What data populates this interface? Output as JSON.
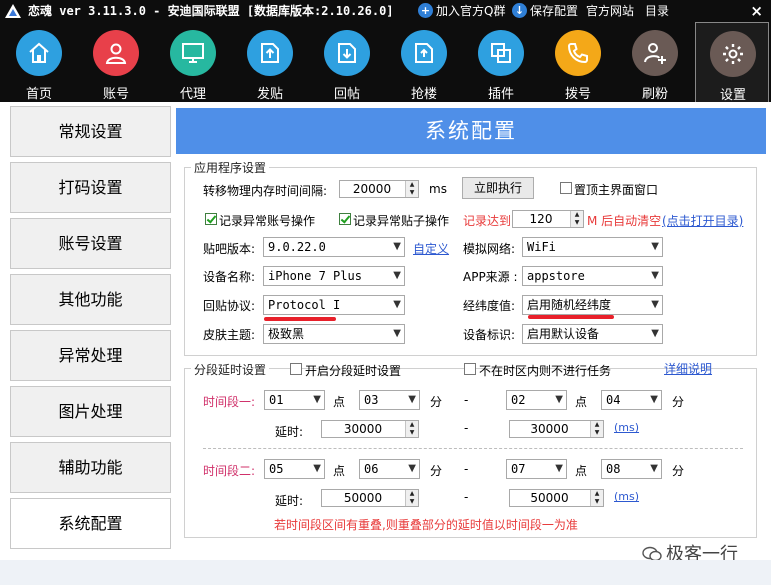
{
  "titlebar": {
    "title": "恋魂 ver 3.11.3.0 - 安迪国际联盟 [数据库版本:2.10.26.0]",
    "join_group": "加入官方Q群",
    "save_config": "保存配置",
    "official_site": "官方网站",
    "directory": "目录",
    "close": "×"
  },
  "toolbar": {
    "items": [
      {
        "label": "首页",
        "icon": "home-icon",
        "color": "#2ea0e0"
      },
      {
        "label": "账号",
        "icon": "user-icon",
        "color": "#e8404a"
      },
      {
        "label": "代理",
        "icon": "monitor-icon",
        "color": "#27b8a0"
      },
      {
        "label": "发贴",
        "icon": "upload-icon",
        "color": "#2ea0e0"
      },
      {
        "label": "回帖",
        "icon": "download-icon",
        "color": "#2ea0e0"
      },
      {
        "label": "抢楼",
        "icon": "document-icon",
        "color": "#2ea0e0"
      },
      {
        "label": "插件",
        "icon": "copy-icon",
        "color": "#2ea0e0"
      },
      {
        "label": "拨号",
        "icon": "phone-icon",
        "color": "#f4a818"
      },
      {
        "label": "刷粉",
        "icon": "user-add-icon",
        "color": "#6a5a55"
      },
      {
        "label": "设置",
        "icon": "gear-icon",
        "color": "#6a5a55"
      }
    ]
  },
  "leftnav": {
    "items": [
      "常规设置",
      "打码设置",
      "账号设置",
      "其他功能",
      "异常处理",
      "图片处理",
      "辅助功能",
      "系统配置"
    ]
  },
  "panel": {
    "title": "系统配置",
    "app_settings": {
      "group_title": "应用程序设置",
      "mem_interval_label": "转移物理内存时间间隔:",
      "mem_interval_value": "20000",
      "mem_interval_unit": "ms",
      "run_now": "立即执行",
      "topmost_label": "置顶主界面窗口",
      "log_account_label": "记录异常账号操作",
      "log_post_label": "记录异常贴子操作",
      "record_reach_label": "记录达到:",
      "record_reach_value": "120",
      "auto_clear_label": "M 后自动清空",
      "open_dir_link": "(点击打开目录)",
      "tieba_version_label": "贴吧版本:",
      "tieba_version_value": "9.0.22.0",
      "customize_link": "自定义",
      "network_label": "模拟网络:",
      "network_value": "WiFi",
      "device_name_label": "设备名称:",
      "device_name_value": "iPhone 7 Plus",
      "app_source_label": "APP来源 :",
      "app_source_value": "appstore",
      "reply_protocol_label": "回贴协议:",
      "reply_protocol_value": "Protocol I",
      "latlng_label": "经纬度值:",
      "latlng_value": "启用随机经纬度",
      "skin_label": "皮肤主题:",
      "skin_value": "极致黑",
      "device_id_label": "设备标识:",
      "device_id_value": "启用默认设备"
    },
    "delay_settings": {
      "group_title": "分段延时设置",
      "enable_label": "开启分段延时设置",
      "skip_label": "不在时区内则不进行任务",
      "detail_link": "详细说明",
      "period1_label": "时间段一:",
      "period2_label": "时间段二:",
      "point_label": "点",
      "minute_label": "分",
      "dash": "-",
      "delay_label": "延时:",
      "ms_link": "(ms)",
      "p1": {
        "start_h": "01",
        "start_m": "03",
        "end_h": "02",
        "end_m": "04",
        "delay_a": "30000",
        "delay_b": "30000"
      },
      "p2": {
        "start_h": "05",
        "start_m": "06",
        "end_h": "07",
        "end_m": "08",
        "delay_a": "50000",
        "delay_b": "50000"
      },
      "note": "若时间段区间有重叠,则重叠部分的延时值以时间段一为准"
    }
  },
  "watermark": "极客一行"
}
